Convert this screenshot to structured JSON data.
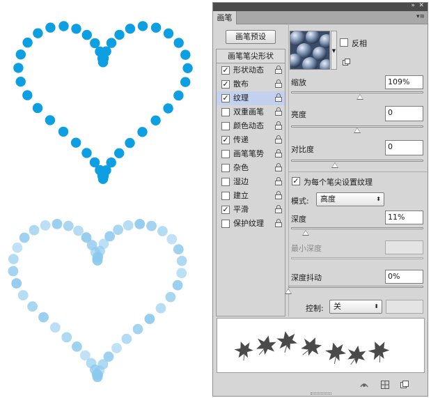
{
  "panel": {
    "tab_label": "画笔",
    "collapse_glyph": "»",
    "close_glyph": "✕",
    "menu_glyph": "▾≡",
    "presets_button": "画笔预设",
    "list_header": "画笔笔尖形状",
    "items": [
      {
        "label": "形状动态",
        "checked": true,
        "selected": false,
        "check": "✓"
      },
      {
        "label": "散布",
        "checked": true,
        "selected": false,
        "check": "✓"
      },
      {
        "label": "纹理",
        "checked": true,
        "selected": true,
        "check": "✓"
      },
      {
        "label": "双重画笔",
        "checked": false,
        "selected": false,
        "check": ""
      },
      {
        "label": "颜色动态",
        "checked": false,
        "selected": false,
        "check": ""
      },
      {
        "label": "传递",
        "checked": true,
        "selected": false,
        "check": "✓"
      },
      {
        "label": "画笔笔势",
        "checked": false,
        "selected": false,
        "check": ""
      },
      {
        "label": "杂色",
        "checked": false,
        "selected": false,
        "check": ""
      },
      {
        "label": "湿边",
        "checked": false,
        "selected": false,
        "check": ""
      },
      {
        "label": "建立",
        "checked": false,
        "selected": false,
        "check": ""
      },
      {
        "label": "平滑",
        "checked": true,
        "selected": false,
        "check": "✓"
      },
      {
        "label": "保护纹理",
        "checked": false,
        "selected": false,
        "check": ""
      }
    ]
  },
  "texture": {
    "invert_label": "反相",
    "invert_checked": false,
    "scale_label": "缩放",
    "scale_value": "109%",
    "scale_level": 0.52,
    "brightness_label": "亮度",
    "brightness_value": "0",
    "brightness_level": 0.5,
    "contrast_label": "对比度",
    "contrast_value": "0",
    "contrast_level": 0.33,
    "per_tip_label": "为每个笔尖设置纹理",
    "per_tip_checked": true,
    "per_tip_check": "✓",
    "mode_label": "模式:",
    "mode_value": "高度",
    "depth_label": "深度",
    "depth_value": "11%",
    "depth_level": 0.11,
    "min_depth_label": "最小深度",
    "min_depth_value": "",
    "depth_jitter_label": "深度抖动",
    "depth_jitter_value": "0%",
    "depth_jitter_level": 0.0,
    "control_label": "控制:",
    "control_value": "关",
    "dropdown_glyph": "⬍"
  },
  "colors": {
    "dot_blue": "#0e9ee2",
    "dot_light": "#8cc9ee",
    "selected_row": "#c3d1ee"
  }
}
